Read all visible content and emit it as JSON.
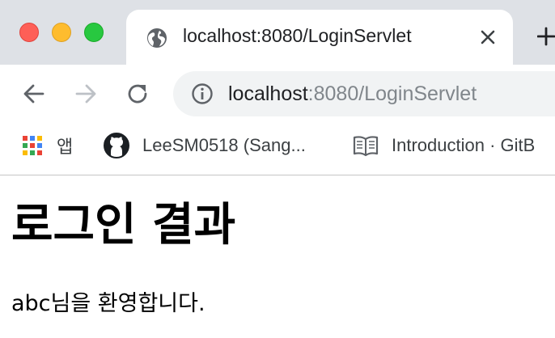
{
  "window": {
    "traffic_lights": {
      "close": "#fe5f57",
      "minimize": "#febc2e",
      "zoom": "#28c840"
    }
  },
  "tab": {
    "title": "localhost:8080/LoginServlet",
    "favicon": "globe-icon",
    "close_icon": "close-icon"
  },
  "new_tab_icon": "plus-icon",
  "toolbar": {
    "back_icon": "arrow-left-icon",
    "forward_icon": "arrow-right-icon",
    "reload_icon": "reload-icon",
    "site_info_icon": "info-icon",
    "url_host": "localhost",
    "url_rest": ":8080/LoginServlet"
  },
  "bookmarks": [
    {
      "label": "앱",
      "icon": "apps-grid-icon"
    },
    {
      "label": "LeeSM0518 (Sang...",
      "icon": "github-icon"
    },
    {
      "label": "Introduction · GitB",
      "icon": "book-icon"
    }
  ],
  "page": {
    "heading": "로그인 결과",
    "message": "abc님을 환영합니다."
  }
}
